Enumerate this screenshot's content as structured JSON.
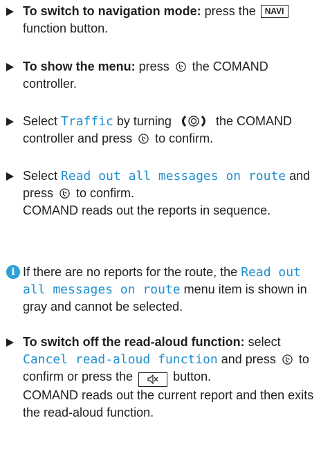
{
  "steps": [
    {
      "bold": "To switch to navigation mode:",
      "text1": " press the ",
      "key": "NAVI",
      "text2": " function button."
    },
    {
      "bold": "To show the menu:",
      "text1": " press ",
      "text2": " the COMAND controller."
    },
    {
      "text1": "Select ",
      "menu": "Traffic",
      "text2": " by turning ",
      "text3": " the COMAND controller and press ",
      "text4": " to confirm."
    },
    {
      "text1": "Select ",
      "menu": "Read out all messages on route",
      "text2": " and press ",
      "text3": " to confirm.",
      "text4": "COMAND reads out the reports in sequence."
    },
    {
      "bold": "To switch off the read-aloud function:",
      "text1": " select ",
      "menu": "Cancel read-aloud function",
      "text2": " and press ",
      "text3": " to confirm or press the ",
      "text4": " button.",
      "text5": "COMAND reads out the current report and then exits the read-aloud function."
    }
  ],
  "note": {
    "icon": "info-icon",
    "text1": "If there are no reports for the route, the ",
    "menu": "Read out all messages on route",
    "text2": " menu item is shown in gray and cannot be selected."
  },
  "icons": {
    "press": "controller-press-icon",
    "turn": "controller-turn-icon",
    "mute": "mute-button-icon"
  },
  "colors": {
    "menu_text": "#1f8fd0",
    "info_icon": "#2f9fd8",
    "body_text": "#1f1f1f"
  }
}
